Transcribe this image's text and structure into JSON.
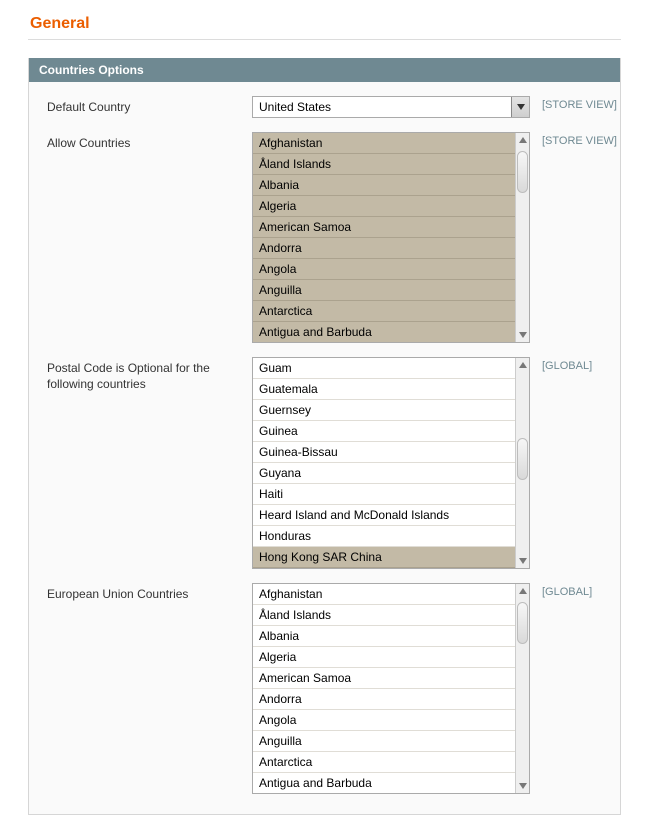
{
  "page": {
    "heading": "General"
  },
  "section": {
    "title": "Countries Options"
  },
  "scopes": {
    "store_view": "[STORE VIEW]",
    "global": "[GLOBAL]"
  },
  "fields": {
    "default_country": {
      "label": "Default Country",
      "value": "United States",
      "scope": "store_view"
    },
    "allow_countries": {
      "label": "Allow Countries",
      "scope": "store_view",
      "all_selected": true,
      "visible_options": [
        "Afghanistan",
        "Åland Islands",
        "Albania",
        "Algeria",
        "American Samoa",
        "Andorra",
        "Angola",
        "Anguilla",
        "Antarctica",
        "Antigua and Barbuda"
      ]
    },
    "postal_optional": {
      "label": "Postal Code is Optional for the following countries",
      "scope": "global",
      "visible_options": [
        "Guam",
        "Guatemala",
        "Guernsey",
        "Guinea",
        "Guinea-Bissau",
        "Guyana",
        "Haiti",
        "Heard Island and McDonald Islands",
        "Honduras",
        "Hong Kong SAR China"
      ],
      "selected_indexes": [
        9
      ]
    },
    "eu_countries": {
      "label": "European Union Countries",
      "scope": "global",
      "visible_options": [
        "Afghanistan",
        "Åland Islands",
        "Albania",
        "Algeria",
        "American Samoa",
        "Andorra",
        "Angola",
        "Anguilla",
        "Antarctica",
        "Antigua and Barbuda"
      ]
    }
  }
}
